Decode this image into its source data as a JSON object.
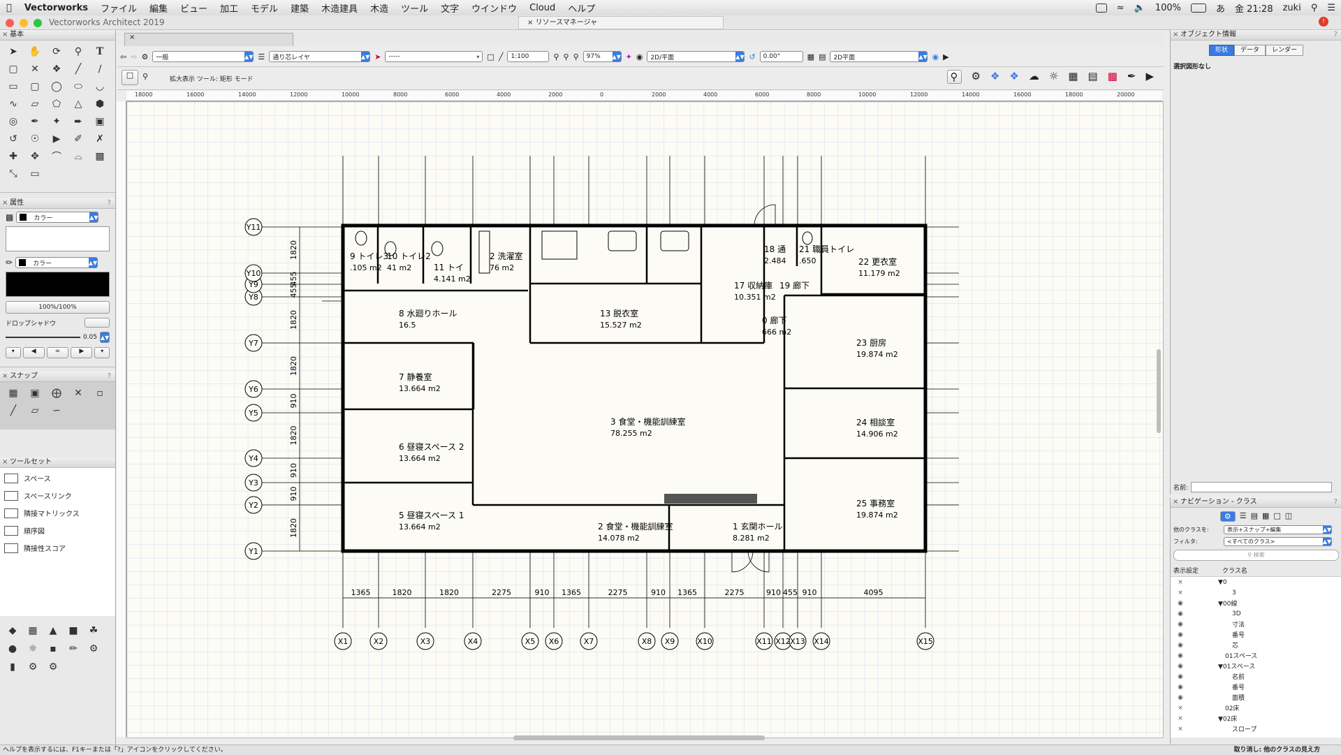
{
  "menubar": {
    "app": "Vectorworks",
    "menus": [
      "ファイル",
      "編集",
      "ビュー",
      "加工",
      "モデル",
      "建築",
      "木造建具",
      "木造",
      "ツール",
      "文字",
      "ウインドウ",
      "Cloud",
      "ヘルプ"
    ],
    "battery": "100%",
    "clock": "金 21:28",
    "user": "zuki",
    "ime": "あ"
  },
  "window": {
    "title": "Vectorworks Architect 2019",
    "resource_manager": "リソースマネージャ"
  },
  "left_panel": {
    "basic_title": "基本",
    "attributes_title": "属性",
    "fill_label": "カラー",
    "pen_label": "カラー",
    "opacity": "100%/100%",
    "drop_shadow": "ドロップシャドウ",
    "line_weight": "0.05",
    "snap_title": "スナップ",
    "toolset_title": "ツールセット",
    "toolset_items": [
      "スペース",
      "スペースリンク",
      "隣接マトリックス",
      "順序図",
      "隣接性スコア"
    ]
  },
  "view_bar": {
    "class": "一般",
    "layer": "通り芯レイヤ",
    "line": "-----",
    "scale": "1:100",
    "zoom": "97%",
    "view": "2D/平面",
    "rotation": "0.00°",
    "render": "2D平面"
  },
  "mode_bar": {
    "hint": "拡大表示 ツール: 矩形 モード"
  },
  "ruler": [
    "18000",
    "16000",
    "14000",
    "12000",
    "10000",
    "8000",
    "6000",
    "4000",
    "2000",
    "0",
    "2000",
    "4000",
    "6000",
    "8000",
    "10000",
    "12000",
    "14000",
    "16000",
    "18000",
    "20000"
  ],
  "status_bar": {
    "help": "ヘルプを表示するには、F1キーまたは「?」アイコンをクリックしてください。",
    "undo": "取り消し: 他のクラスの見え方"
  },
  "object_info": {
    "title": "オブジェクト情報",
    "tabs": [
      "形状",
      "データ",
      "レンダー"
    ],
    "selection": "選択図形なし",
    "name_label": "名前:"
  },
  "navigation": {
    "title": "ナビゲーション - クラス",
    "other_classes_label": "他のクラスを:",
    "other_classes_value": "表示+スナップ+編集",
    "filter_label": "フィルタ:",
    "filter_value": "<すべてのクラス>",
    "search_placeholder": "検索",
    "col_visibility": "表示設定",
    "col_class": "クラス名",
    "rows": [
      {
        "vis": "×",
        "name": "▼0",
        "indent": 0
      },
      {
        "vis": "×",
        "name": "3",
        "indent": 2
      },
      {
        "vis": "◉",
        "name": "▼00線",
        "indent": 0
      },
      {
        "vis": "◉",
        "name": "3D",
        "indent": 2
      },
      {
        "vis": "◉",
        "name": "寸法",
        "indent": 2
      },
      {
        "vis": "◉",
        "name": "番号",
        "indent": 2
      },
      {
        "vis": "◉",
        "name": "芯",
        "indent": 2
      },
      {
        "vis": "◉",
        "name": "01スペース",
        "indent": 1
      },
      {
        "vis": "◉",
        "name": "▼01スペース",
        "indent": 0
      },
      {
        "vis": "◉",
        "name": "名前",
        "indent": 2
      },
      {
        "vis": "◉",
        "name": "番号",
        "indent": 2
      },
      {
        "vis": "◉",
        "name": "面積",
        "indent": 2
      },
      {
        "vis": "×",
        "name": "02床",
        "indent": 1
      },
      {
        "vis": "×",
        "name": "▼02床",
        "indent": 0
      },
      {
        "vis": "×",
        "name": "スロープ",
        "indent": 2
      }
    ]
  },
  "plan": {
    "rooms": [
      {
        "name": "9 トイレ3",
        "area": ".105 m2"
      },
      {
        "name": "10 トイレ2",
        "area": "41 m2"
      },
      {
        "name": "11 トイ",
        "area": "4.141 m2"
      },
      {
        "name": "2 洗濯室",
        "area": "76 m2"
      },
      {
        "name": "18 通",
        "area": "2.484"
      },
      {
        "name": "21 職員トイレ",
        "area": ".650"
      },
      {
        "name": "22 更衣室",
        "area": "11.179 m2"
      },
      {
        "name": "17 収納庫",
        "area": "10.351 m2"
      },
      {
        "name": "19 廊下",
        "area": ""
      },
      {
        "name": "8 水廻りホール",
        "area": "16.5"
      },
      {
        "name": "13 脱衣室",
        "area": "15.527 m2"
      },
      {
        "name": "0 廊下",
        "area": "666 m2"
      },
      {
        "name": "23 厨房",
        "area": "19.874 m2"
      },
      {
        "name": "7 静養室",
        "area": "13.664 m2"
      },
      {
        "name": "3 食堂・機能訓練室",
        "area": "78.255 m2"
      },
      {
        "name": "24 相談室",
        "area": "14.906 m2"
      },
      {
        "name": "6 昼寝スペース 2",
        "area": "13.664 m2"
      },
      {
        "name": "5 昼寝スペース 1",
        "area": "13.664 m2"
      },
      {
        "name": "2 食堂・機能訓練室",
        "area": "14.078 m2"
      },
      {
        "name": "1 玄関ホール",
        "area": "8.281 m2"
      },
      {
        "name": "25 事務室",
        "area": "19.874 m2"
      }
    ],
    "x_axes": [
      "X1",
      "X2",
      "X3",
      "X4",
      "X5",
      "X6",
      "X7",
      "X8",
      "X9",
      "X10",
      "X11",
      "X12",
      "X13",
      "X14",
      "X15"
    ],
    "y_axes": [
      "Y1",
      "Y2",
      "Y3",
      "Y4",
      "Y5",
      "Y6",
      "Y7",
      "Y8",
      "Y9",
      "Y10",
      "Y11"
    ],
    "x_dims": [
      "1365",
      "1820",
      "1820",
      "2275",
      "910",
      "1365",
      "2275",
      "910",
      "1365",
      "2275",
      "910",
      "455",
      "910",
      "4095"
    ],
    "y_dims": [
      "1820",
      "910",
      "910",
      "1820",
      "910",
      "1820",
      "1820",
      "455",
      "455",
      "1820"
    ]
  }
}
